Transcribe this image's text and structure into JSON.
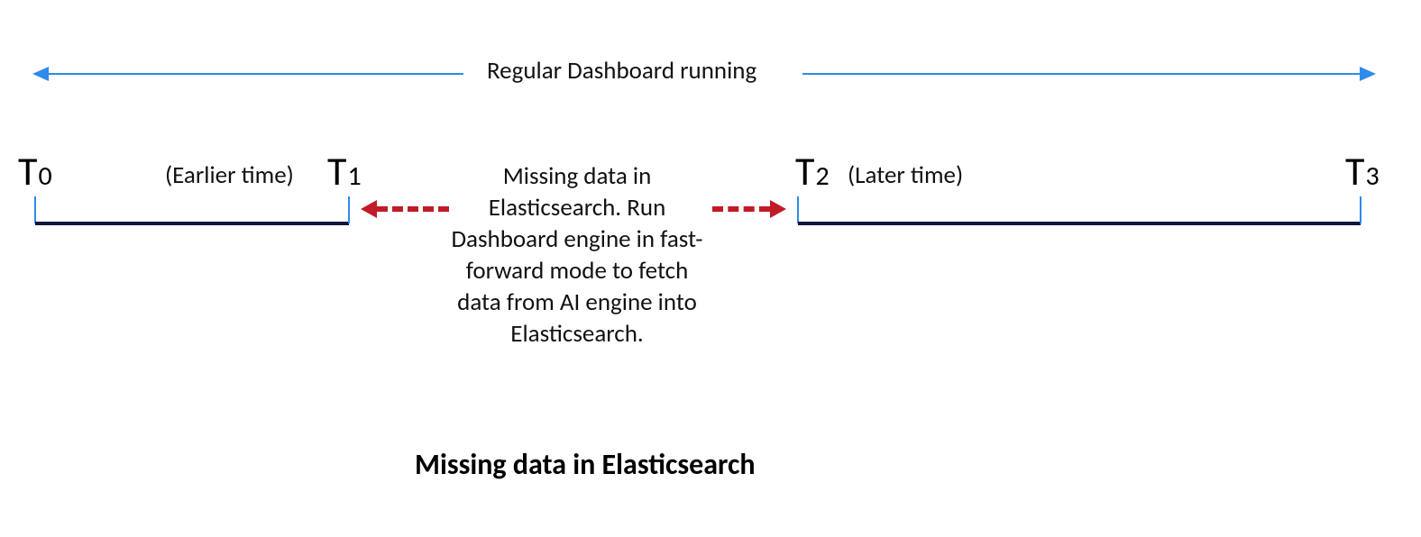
{
  "top_label": "Regular Dashboard running",
  "t0": "T",
  "t0sub": "0",
  "t1": "T",
  "t1sub": "1",
  "t2": "T",
  "t2sub": "2",
  "t3": "T",
  "t3sub": "3",
  "earlier": "(Earlier time)",
  "later": "(Later time)",
  "center_text": "Missing data in Elasticsearch. Run Dashboard engine in fast-forward mode to fetch data from AI engine into Elasticsearch.",
  "caption": "Missing data in Elasticsearch",
  "colors": {
    "blue": "#2E8BEA",
    "navy": "#0D173B",
    "red": "#C11B27"
  }
}
